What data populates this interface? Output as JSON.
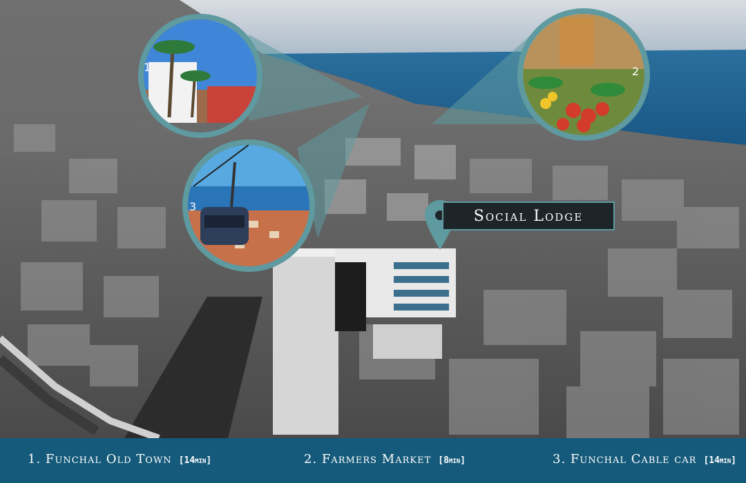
{
  "marker": {
    "label": "Social Lodge"
  },
  "badges": [
    "1",
    "2",
    "3"
  ],
  "stops": [
    {
      "name": "1. Funchal Old Town",
      "duration": "[14min]"
    },
    {
      "name": "2. Farmers Market",
      "duration": "[8min]"
    },
    {
      "name": "3. Funchal Cable car",
      "duration": "[14min]"
    }
  ],
  "colors": {
    "accent": "#5e9aa0",
    "bar": "#155a7a",
    "sea": "#1f5f8e"
  }
}
